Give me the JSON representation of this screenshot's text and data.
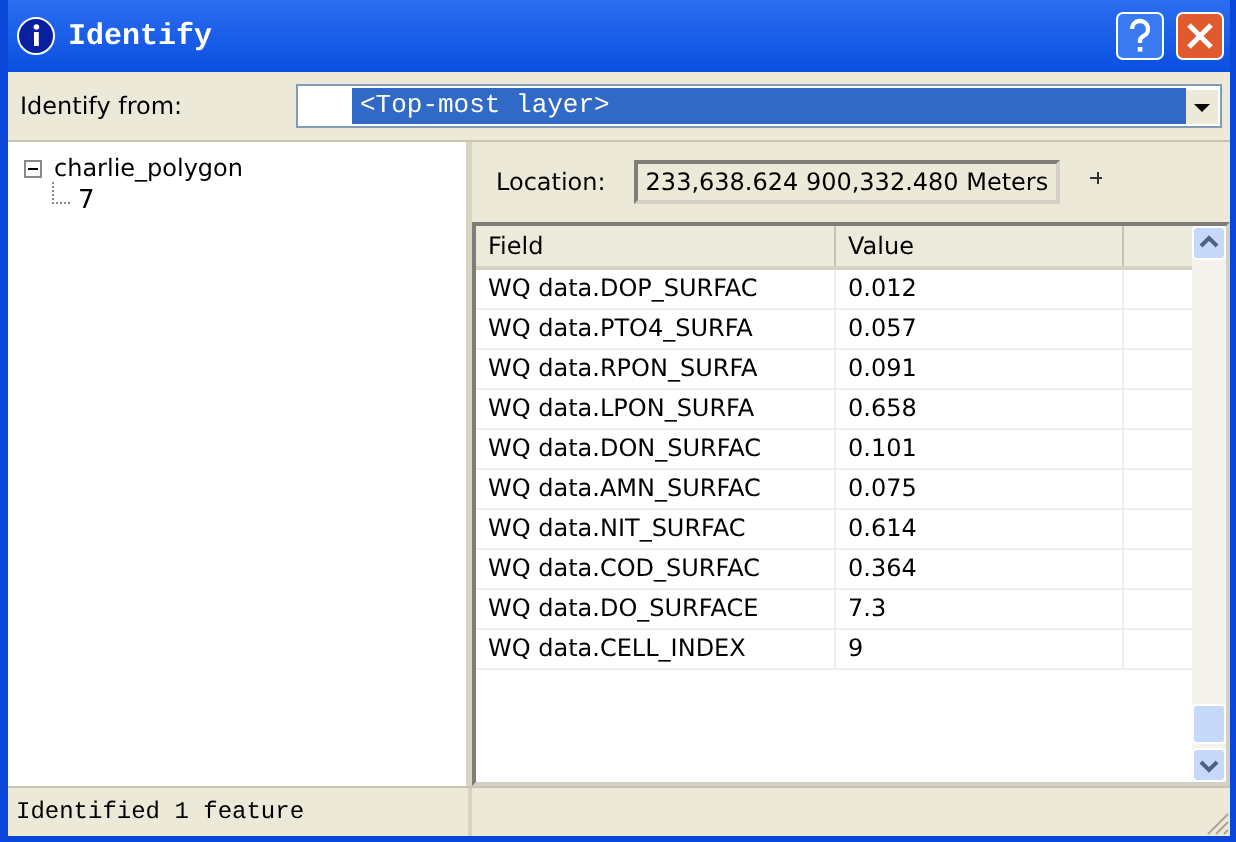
{
  "window": {
    "title": "Identify"
  },
  "identify_from": {
    "label": "Identify from:",
    "value": "<Top-most layer>"
  },
  "tree": [
    {
      "label": "charlie_polygon",
      "expanded": true,
      "children": [
        {
          "label": "7"
        }
      ]
    }
  ],
  "location": {
    "label": "Location:",
    "value": "233,638.624  900,332.480 Meters"
  },
  "table": {
    "columns": [
      "Field",
      "Value"
    ],
    "rows": [
      [
        "WQ data.DOP_SURFAC",
        "0.012"
      ],
      [
        "WQ data.PTO4_SURFA",
        "0.057"
      ],
      [
        "WQ data.RPON_SURFA",
        "0.091"
      ],
      [
        "WQ data.LPON_SURFA",
        "0.658"
      ],
      [
        "WQ data.DON_SURFAC",
        "0.101"
      ],
      [
        "WQ data.AMN_SURFAC",
        "0.075"
      ],
      [
        "WQ data.NIT_SURFAC",
        "0.614"
      ],
      [
        "WQ data.COD_SURFAC",
        "0.364"
      ],
      [
        "WQ data.DO_SURFACE",
        "7.3"
      ],
      [
        "WQ data.CELL_INDEX",
        "9"
      ]
    ]
  },
  "status_bar": "Identified 1 feature"
}
